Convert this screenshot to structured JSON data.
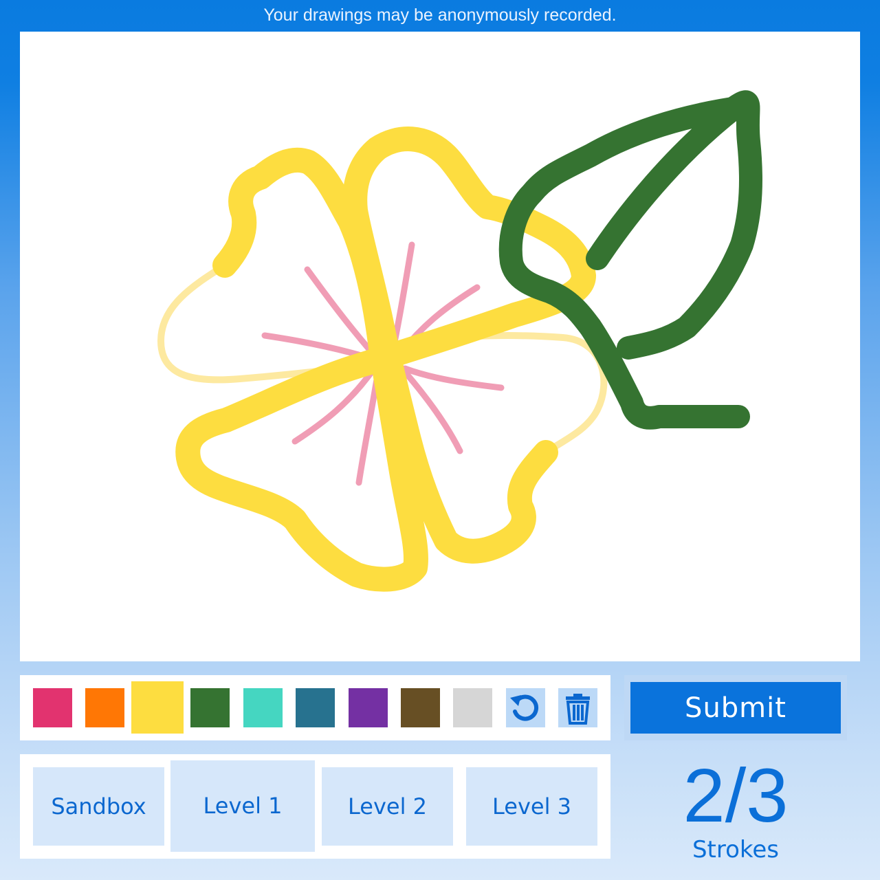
{
  "notice": "Your drawings may be anonymously recorded.",
  "palette": {
    "colors": [
      {
        "name": "pink",
        "hex": "#e2336f"
      },
      {
        "name": "orange",
        "hex": "#ff7705"
      },
      {
        "name": "yellow",
        "hex": "#fddd40"
      },
      {
        "name": "green",
        "hex": "#357331"
      },
      {
        "name": "teal",
        "hex": "#45d6c1"
      },
      {
        "name": "blue",
        "hex": "#27728f"
      },
      {
        "name": "purple",
        "hex": "#7430a3"
      },
      {
        "name": "brown",
        "hex": "#674f24"
      },
      {
        "name": "light-gray",
        "hex": "#d6d6d6"
      }
    ],
    "selected": "yellow",
    "tools": [
      {
        "name": "undo",
        "icon": "undo-icon"
      },
      {
        "name": "clear",
        "icon": "trash-icon"
      }
    ]
  },
  "submit": {
    "label": "Submit"
  },
  "levels": [
    {
      "label": "Sandbox",
      "active": false
    },
    {
      "label": "Level 1",
      "active": true
    },
    {
      "label": "Level 2",
      "active": false
    },
    {
      "label": "Level 3",
      "active": false
    }
  ],
  "counter": {
    "value": "2/3",
    "label": "Strokes"
  },
  "colors": {
    "accent": "#0a73dc",
    "text_blue": "#0b6fd8",
    "stroke_yellow": "#fddd40",
    "stroke_yellow_faint": "#fde9a0",
    "stroke_green": "#357331",
    "stroke_pink": "#f09db5"
  }
}
